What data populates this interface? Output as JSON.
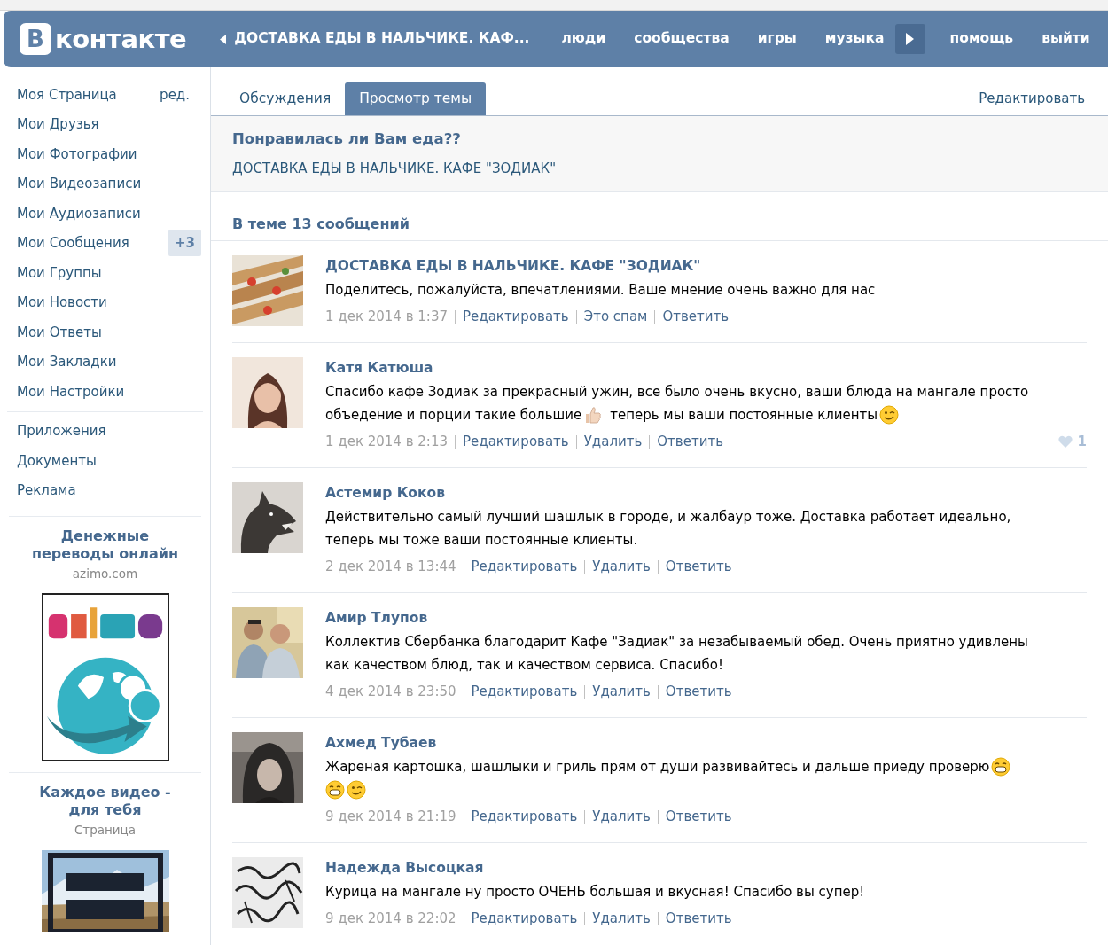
{
  "header": {
    "logo_letter": "В",
    "logo_text": "контакте",
    "topic_link": "ДОСТАВКА ЕДЫ В НАЛЬЧИКЕ. КАФ...",
    "nav": [
      "люди",
      "сообщества",
      "игры",
      "музыка"
    ],
    "nav_right": [
      "помощь",
      "выйти"
    ]
  },
  "sidebar": {
    "items": [
      {
        "label": "Моя Страница",
        "extra": "ред.",
        "kind": "edit"
      },
      {
        "label": "Мои Друзья",
        "kind": "plain"
      },
      {
        "label": "Мои Фотографии",
        "kind": "plain"
      },
      {
        "label": "Мои Видеозаписи",
        "kind": "plain"
      },
      {
        "label": "Мои Аудиозаписи",
        "kind": "plain"
      },
      {
        "label": "Мои Сообщения",
        "extra": "+3",
        "kind": "badge"
      },
      {
        "label": "Мои Группы",
        "kind": "plain"
      },
      {
        "label": "Мои Новости",
        "kind": "plain"
      },
      {
        "label": "Мои Ответы",
        "kind": "plain"
      },
      {
        "label": "Мои Закладки",
        "kind": "plain"
      },
      {
        "label": "Мои Настройки",
        "kind": "plain"
      }
    ],
    "more_items": [
      "Приложения",
      "Документы",
      "Реклама"
    ],
    "ads": [
      {
        "title": "Денежные переводы онлайн",
        "subtitle": "azimo.com",
        "kind": "globe"
      },
      {
        "title": "Каждое видео - для тебя",
        "subtitle": "Страница",
        "kind": "landscape"
      }
    ]
  },
  "tabs": [
    {
      "label": "Обсуждения",
      "selected": false
    },
    {
      "label": "Просмотр темы",
      "selected": true
    }
  ],
  "edit_link": "Редактировать",
  "topic": {
    "title": "Понравилась ли Вам еда??",
    "group": "ДОСТАВКА ЕДЫ В НАЛЬЧИКЕ. КАФЕ \"ЗОДИАК\""
  },
  "count_label": "В теме 13 сообщений",
  "posts": [
    {
      "author": "ДОСТАВКА ЕДЫ В НАЛЬЧИКЕ. КАФЕ \"ЗОДИАК\"",
      "body": [
        [
          {
            "kind": "text",
            "text": "Поделитесь, пожалуйста, впечатлениями. Ваше мнение очень важно для нас"
          }
        ]
      ],
      "date": "1 дек 2014 в 1:37",
      "actions": [
        "Редактировать",
        "Это спам",
        "Ответить"
      ]
    },
    {
      "author": "Катя Катюша",
      "body": [
        [
          {
            "kind": "text",
            "text": "Спасибо кафе Зодиак за прекрасный ужин, все было очень вкусно, ваши блюда на мангале просто"
          }
        ],
        [
          {
            "kind": "text",
            "text": "объедение и порции такие большие"
          },
          {
            "kind": "thumbs"
          },
          {
            "kind": "text",
            "text": "теперь мы ваши постоянные клиенты"
          },
          {
            "kind": "wink"
          }
        ]
      ],
      "date": "1 дек 2014 в 2:13",
      "actions": [
        "Редактировать",
        "Удалить",
        "Ответить"
      ],
      "likes": "1"
    },
    {
      "author": "Астемир Коков",
      "body": [
        [
          {
            "kind": "text",
            "text": "Действительно самый лучший шашлык в городе, и жалбаур тоже. Доставка работает идеально,"
          }
        ],
        [
          {
            "kind": "text",
            "text": "теперь мы тоже ваши постоянные клиенты."
          }
        ]
      ],
      "date": "2 дек 2014 в 13:44",
      "actions": [
        "Редактировать",
        "Удалить",
        "Ответить"
      ]
    },
    {
      "author": "Амир Тлупов",
      "body": [
        [
          {
            "kind": "text",
            "text": "Коллектив Сбербанка благодарит Кафе \"Задиак\" за незабываемый обед. Очень приятно удивлены"
          }
        ],
        [
          {
            "kind": "text",
            "text": "как качеством блюд, так и качеством сервиса. Спасибо!"
          }
        ]
      ],
      "date": "4 дек 2014 в 23:50",
      "actions": [
        "Редактировать",
        "Удалить",
        "Ответить"
      ]
    },
    {
      "author": "Ахмед Тубаев",
      "body": [
        [
          {
            "kind": "text",
            "text": "Жареная картошка, шашлыки и гриль прям от души развивайтесь и дальше приеду проверю"
          },
          {
            "kind": "grin"
          }
        ],
        [
          {
            "kind": "grin"
          },
          {
            "kind": "wink"
          }
        ]
      ],
      "date": "9 дек 2014 в 21:19",
      "actions": [
        "Редактировать",
        "Удалить",
        "Ответить"
      ]
    },
    {
      "author": "Надежда Высоцкая",
      "body": [
        [
          {
            "kind": "text",
            "text": "Курица на мангале ну просто ОЧЕНЬ большая и вкусная! Спасибо вы супер!"
          }
        ]
      ],
      "date": "9 дек 2014 в 22:02",
      "actions": [
        "Редактировать",
        "Удалить",
        "Ответить"
      ]
    }
  ]
}
